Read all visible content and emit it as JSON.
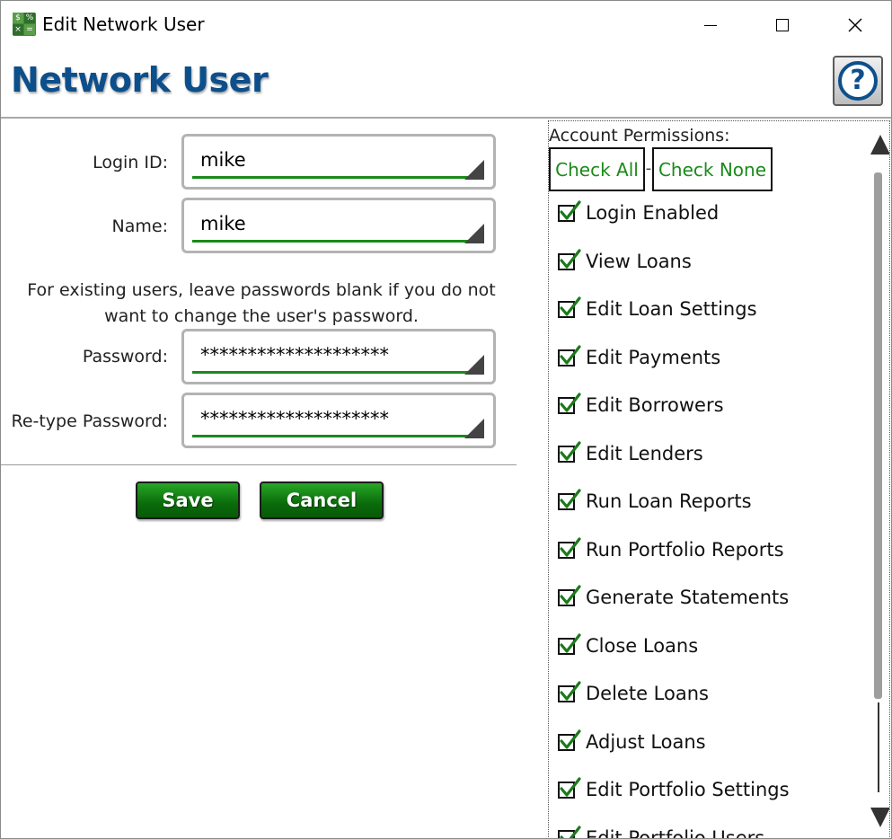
{
  "window": {
    "title": "Edit Network User",
    "icon_glyphs": [
      "$",
      "%",
      "×",
      "="
    ]
  },
  "header": {
    "title": "Network User",
    "help_glyph": "?"
  },
  "form": {
    "login_id": {
      "label": "Login ID:",
      "value": "mike"
    },
    "name": {
      "label": "Name:",
      "value": "mike"
    },
    "note": "For existing users, leave passwords blank if you do not want to change the user's password.",
    "password": {
      "label": "Password:",
      "value": "********************"
    },
    "retype_password": {
      "label": "Re-type Password:",
      "value": "********************"
    }
  },
  "buttons": {
    "save": "Save",
    "cancel": "Cancel"
  },
  "permissions": {
    "title": "Account Permissions:",
    "check_all": "Check All",
    "separator": "-",
    "check_none": "Check None",
    "items": [
      {
        "label": "Login Enabled",
        "checked": true
      },
      {
        "label": "View Loans",
        "checked": true
      },
      {
        "label": "Edit Loan Settings",
        "checked": true
      },
      {
        "label": "Edit Payments",
        "checked": true
      },
      {
        "label": "Edit Borrowers",
        "checked": true
      },
      {
        "label": "Edit Lenders",
        "checked": true
      },
      {
        "label": "Run Loan Reports",
        "checked": true
      },
      {
        "label": "Run Portfolio Reports",
        "checked": true
      },
      {
        "label": "Generate Statements",
        "checked": true
      },
      {
        "label": "Close Loans",
        "checked": true
      },
      {
        "label": "Delete Loans",
        "checked": true
      },
      {
        "label": "Adjust Loans",
        "checked": true
      },
      {
        "label": "Edit Portfolio Settings",
        "checked": true
      },
      {
        "label": "Edit Portfolio Users",
        "checked": true
      }
    ]
  },
  "colors": {
    "title_blue": "#0d4f8b",
    "accent_green": "#1a8a1a",
    "button_green": "#0a6b0a"
  }
}
